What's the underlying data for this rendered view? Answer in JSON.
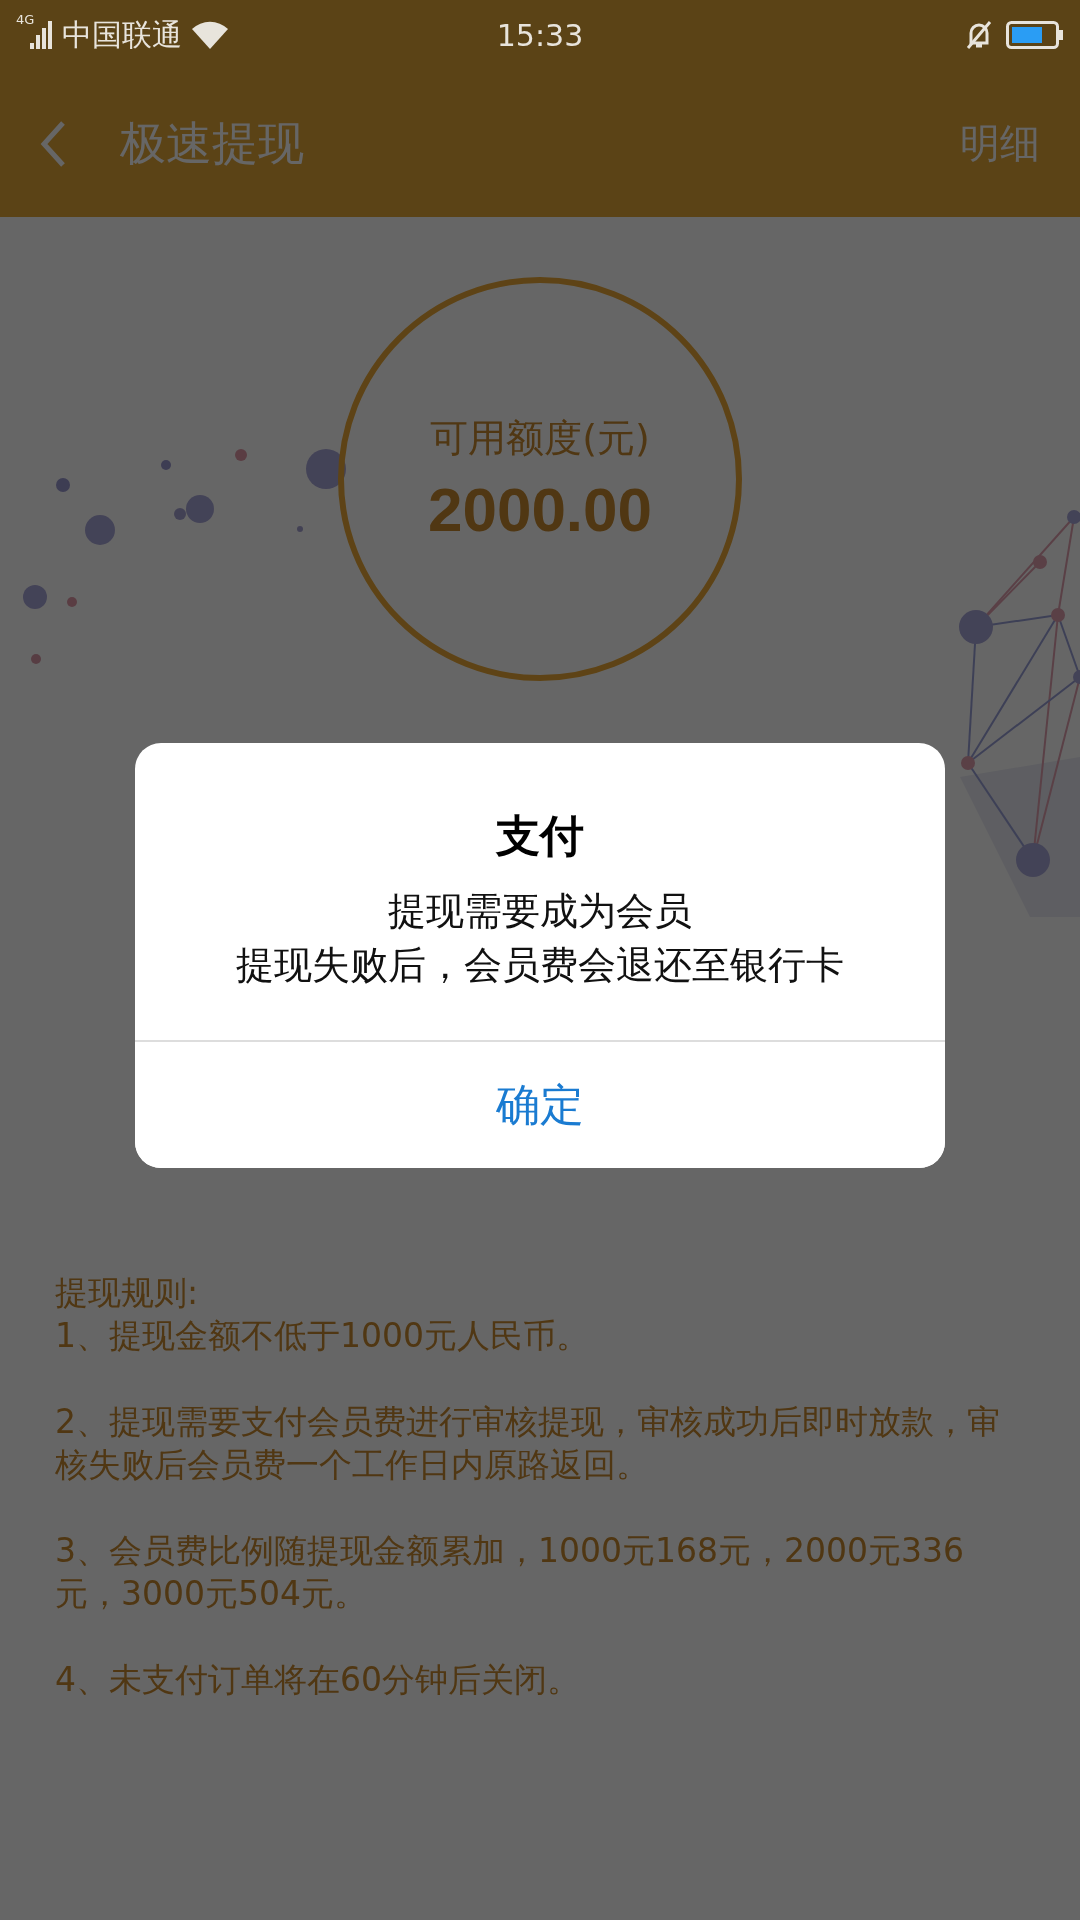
{
  "status_bar": {
    "network": "4G",
    "carrier": "中国联通",
    "time": "15:33"
  },
  "header": {
    "title": "极速提现",
    "action": "明细"
  },
  "quota": {
    "label": "可用额度(元)",
    "amount": "2000.00"
  },
  "rules": {
    "title": "提现规则:",
    "items": [
      "1、提现金额不低于1000元人民币。",
      "2、提现需要支付会员费进行审核提现，审核成功后即时放款，审核失败后会员费一个工作日内原路返回。",
      "3、会员费比例随提现金额累加，1000元168元，2000元336元，3000元504元。",
      "4、未支付订单将在60分钟后关闭。"
    ]
  },
  "dialog": {
    "title": "支付",
    "message_lines": [
      "提现需要成为会员",
      "提现失败后，会员费会退还至银行卡"
    ],
    "button": "确定"
  }
}
